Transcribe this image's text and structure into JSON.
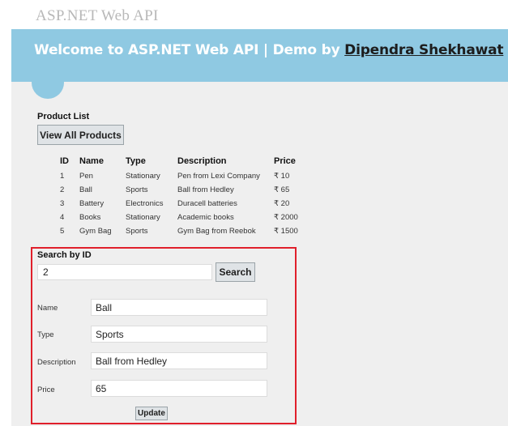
{
  "header": {
    "site_title": "ASP.NET Web API",
    "banner_text": "Welcome to ASP.NET Web API | Demo by ",
    "banner_author": "Dipendra Shekhawat"
  },
  "product_list": {
    "heading": "Product List",
    "view_all_label": "View All Products",
    "columns": [
      "ID",
      "Name",
      "Type",
      "Description",
      "Price"
    ],
    "rows": [
      [
        "1",
        "Pen",
        "Stationary",
        "Pen from Lexi Company",
        "₹ 10"
      ],
      [
        "2",
        "Ball",
        "Sports",
        "Ball from Hedley",
        "₹ 65"
      ],
      [
        "3",
        "Battery",
        "Electronics",
        "Duracell batteries",
        "₹ 20"
      ],
      [
        "4",
        "Books",
        "Stationary",
        "Academic books",
        "₹ 2000"
      ],
      [
        "5",
        "Gym Bag",
        "Sports",
        "Gym Bag from Reebok",
        "₹ 1500"
      ]
    ]
  },
  "search": {
    "heading": "Search by ID",
    "id_value": "2",
    "search_label": "Search"
  },
  "details": {
    "name_label": "Name",
    "name_value": "Ball",
    "type_label": "Type",
    "type_value": "Sports",
    "description_label": "Description",
    "description_value": "Ball from Hedley",
    "price_label": "Price",
    "price_value": "65",
    "update_label": "Update"
  },
  "colors": {
    "banner": "#8fc9e2",
    "highlight_border": "#e01f2b",
    "page_background": "#efefef"
  }
}
